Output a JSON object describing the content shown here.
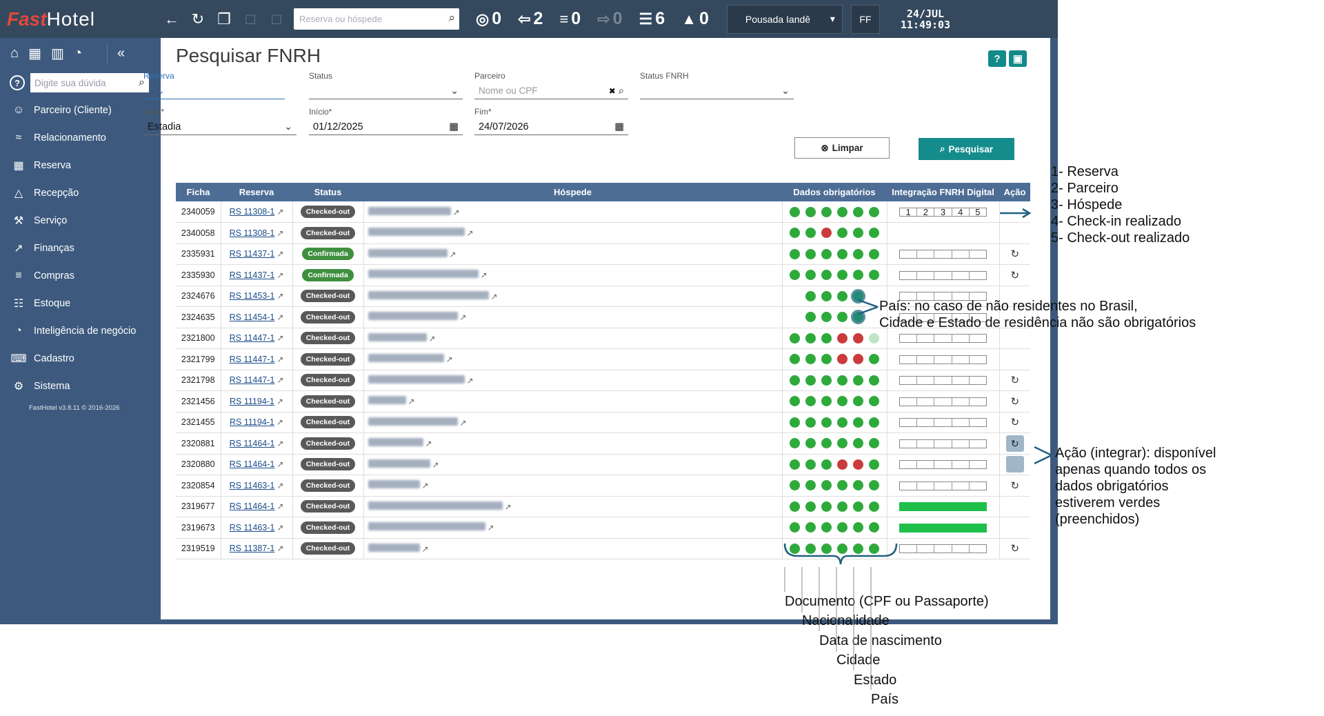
{
  "topbar": {
    "logo_fast": "Fast",
    "logo_hotel": "Hotel",
    "search_placeholder": "Reserva ou hóspede",
    "counters": [
      {
        "icon": "target-icon",
        "value": "0",
        "dim": false
      },
      {
        "icon": "arrival-icon",
        "value": "2",
        "dim": false
      },
      {
        "icon": "bed-icon",
        "value": "0",
        "dim": false
      },
      {
        "icon": "departure-icon",
        "value": "0",
        "dim": true
      },
      {
        "icon": "list-icon",
        "value": "6",
        "dim": false
      },
      {
        "icon": "bell-icon",
        "value": "0",
        "dim": false
      }
    ],
    "hotel": "Pousada Iandê",
    "user_initials": "FF",
    "date": "24/JUL",
    "time": "11:49:03"
  },
  "sidebar": {
    "help_placeholder": "Digite sua dúvida",
    "items": [
      {
        "label": "Parceiro (Cliente)",
        "icon": "user-icon"
      },
      {
        "label": "Relacionamento",
        "icon": "handshake-icon"
      },
      {
        "label": "Reserva",
        "icon": "calendar-icon"
      },
      {
        "label": "Recepção",
        "icon": "bell-desk-icon"
      },
      {
        "label": "Serviço",
        "icon": "service-icon"
      },
      {
        "label": "Finanças",
        "icon": "chart-icon"
      },
      {
        "label": "Compras",
        "icon": "cart-icon"
      },
      {
        "label": "Estoque",
        "icon": "boxes-icon"
      },
      {
        "label": "Inteligência de negócio",
        "icon": "gauge-icon"
      },
      {
        "label": "Cadastro",
        "icon": "keyboard-icon"
      },
      {
        "label": "Sistema",
        "icon": "gear-icon"
      }
    ],
    "version": "FastHotel v3.8.11 © 2016-2026"
  },
  "page": {
    "title": "Pesquisar FNRH",
    "help_btn": "?",
    "filters": {
      "reserva_label": "Reserva",
      "status_label": "Status",
      "parceiro_label": "Parceiro",
      "parceiro_placeholder": "Nome ou CPF",
      "status_fnrh_label": "Status FNRH",
      "data_label": "Data*",
      "data_value": "Estadia",
      "inicio_label": "Início*",
      "inicio_value": "01/12/2025",
      "fim_label": "Fim*",
      "fim_value": "24/07/2026",
      "clear_label": "Limpar",
      "search_label": "Pesquisar"
    },
    "table": {
      "headers": [
        "Ficha",
        "Reserva",
        "Status",
        "Hóspede",
        "Dados obrigatórios",
        "Integração FNRH Digital",
        "Ação"
      ],
      "rows": [
        {
          "ficha": "2340059",
          "reserva": "RS 11308-1",
          "status": "Checked-out",
          "dots": "gggggg",
          "bar": "nums",
          "acao": "arrow",
          "blurw": 120
        },
        {
          "ficha": "2340058",
          "reserva": "RS 11308-1",
          "status": "Checked-out",
          "dots": "ggrggg",
          "bar": "",
          "acao": "",
          "blurw": 140
        },
        {
          "ficha": "2335931",
          "reserva": "RS 11437-1",
          "status": "Confirmada",
          "dots": "gggggg",
          "bar": "empty",
          "acao": "refresh",
          "blurw": 115
        },
        {
          "ficha": "2335930",
          "reserva": "RS 11437-1",
          "status": "Confirmada",
          "dots": "gggggg",
          "bar": "empty",
          "acao": "refresh",
          "blurw": 160
        },
        {
          "ficha": "2324676",
          "reserva": "RS 11453-1",
          "status": "Checked-out",
          "dots": "gggt",
          "bar": "empty",
          "acao": "",
          "blurw": 175
        },
        {
          "ficha": "2324635",
          "reserva": "RS 11454-1",
          "status": "Checked-out",
          "dots": "gggt",
          "bar": "empty",
          "acao": "",
          "blurw": 130
        },
        {
          "ficha": "2321800",
          "reserva": "RS 11447-1",
          "status": "Checked-out",
          "dots": "gggrrp",
          "bar": "empty",
          "acao": "",
          "blurw": 85
        },
        {
          "ficha": "2321799",
          "reserva": "RS 11447-1",
          "status": "Checked-out",
          "dots": "gggrrg",
          "bar": "empty",
          "acao": "",
          "blurw": 110
        },
        {
          "ficha": "2321798",
          "reserva": "RS 11447-1",
          "status": "Checked-out",
          "dots": "gggggg",
          "bar": "empty",
          "acao": "refresh",
          "blurw": 140
        },
        {
          "ficha": "2321456",
          "reserva": "RS 11194-1",
          "status": "Checked-out",
          "dots": "gggggg",
          "bar": "empty",
          "acao": "refresh",
          "blurw": 55
        },
        {
          "ficha": "2321455",
          "reserva": "RS 11194-1",
          "status": "Checked-out",
          "dots": "gggggg",
          "bar": "empty",
          "acao": "refresh",
          "blurw": 130
        },
        {
          "ficha": "2320881",
          "reserva": "RS 11464-1",
          "status": "Checked-out",
          "dots": "gggggg",
          "bar": "empty",
          "acao": "btn",
          "blurw": 80
        },
        {
          "ficha": "2320880",
          "reserva": "RS 11464-1",
          "status": "Checked-out",
          "dots": "gggrrg",
          "bar": "empty",
          "acao": "btnempty",
          "blurw": 90
        },
        {
          "ficha": "2320854",
          "reserva": "RS 11463-1",
          "status": "Checked-out",
          "dots": "gggggg",
          "bar": "empty",
          "acao": "refresh",
          "blurw": 75
        },
        {
          "ficha": "2319677",
          "reserva": "RS 11464-1",
          "status": "Checked-out",
          "dots": "gggggg",
          "bar": "full",
          "acao": "",
          "blurw": 195
        },
        {
          "ficha": "2319673",
          "reserva": "RS 11463-1",
          "status": "Checked-out",
          "dots": "gggggg",
          "bar": "full",
          "acao": "",
          "blurw": 170
        },
        {
          "ficha": "2319519",
          "reserva": "RS 11387-1",
          "status": "Checked-out",
          "dots": "gggggg",
          "bar": "empty",
          "acao": "refresh",
          "blurw": 75
        }
      ],
      "bar_numbers": [
        "1",
        "2",
        "3",
        "4",
        "5"
      ]
    }
  },
  "annotations": {
    "legend": [
      "1- Reserva",
      "2- Parceiro",
      "3- Hóspede",
      "4- Check-in realizado",
      "5- Check-out realizado"
    ],
    "pais_line1": "País: no caso de não residentes no Brasil,",
    "pais_line2": "Cidade e Estado de residência não são obrigatórios",
    "acao_lines": [
      "Ação (integrar): disponível",
      "apenas quando todos os",
      "dados obrigatórios",
      "estiverem verdes",
      "(preenchidos)"
    ],
    "dados_labels": [
      "Documento (CPF ou Passaporte)",
      "Nacionalidade",
      "Data de nascimento",
      "Cidade",
      "Estado",
      "País"
    ]
  }
}
